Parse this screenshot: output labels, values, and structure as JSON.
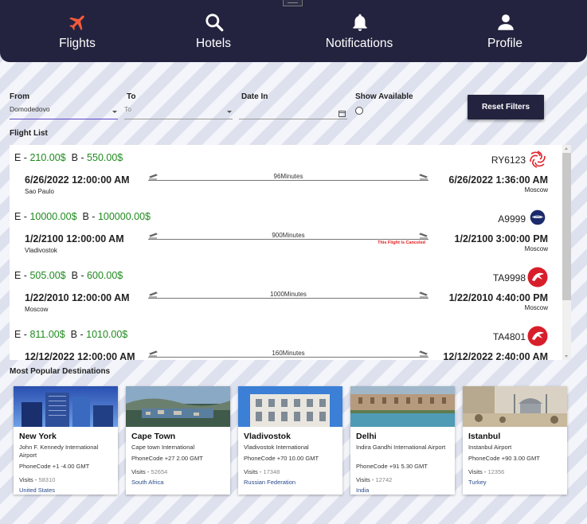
{
  "nav": {
    "items": [
      {
        "label": "Flights",
        "icon": "airplane-icon",
        "active": true
      },
      {
        "label": "Hotels",
        "icon": "search-icon"
      },
      {
        "label": "Notifications",
        "icon": "bell-icon"
      },
      {
        "label": "Profile",
        "icon": "user-icon"
      }
    ]
  },
  "filters": {
    "from": {
      "label": "From",
      "value": "Domodedovo"
    },
    "to": {
      "label": "To",
      "placeholder": "To"
    },
    "date_in": {
      "label": "Date In",
      "value": ""
    },
    "show_available": {
      "label": "Show Available"
    },
    "reset_label": "Reset Filters"
  },
  "flight_list": {
    "title": "Flight List",
    "flights": [
      {
        "economy_label": "E - ",
        "economy": "210.00$",
        "business_label": "B - ",
        "business": "550.00$",
        "number": "RY6123",
        "airline_logo": "red-swirl-logo",
        "departure_time": "6/26/2022 12:00:00 AM",
        "departure_city": "Sao Paulo",
        "arrival_time": "6/26/2022 1:36:00 AM",
        "arrival_city": "Moscow",
        "duration": "96Minutes",
        "status": ""
      },
      {
        "economy_label": "E - ",
        "economy": "10000.00$",
        "business_label": "B - ",
        "business": "100000.00$",
        "number": "A9999",
        "airline_logo": "airbus-logo",
        "departure_time": "1/2/2100 12:00:00 AM",
        "departure_city": "Vladivostok",
        "arrival_time": "1/2/2100 3:00:00 PM",
        "arrival_city": "Moscow",
        "duration": "900Minutes",
        "status": "This Flight Is Canceled"
      },
      {
        "economy_label": "E - ",
        "economy": "505.00$",
        "business_label": "B - ",
        "business": "600.00$",
        "number": "TA9998",
        "airline_logo": "turkish-airlines-logo",
        "departure_time": "1/22/2010 12:00:00 AM",
        "departure_city": "Moscow",
        "arrival_time": "1/22/2010 4:40:00 PM",
        "arrival_city": "Moscow",
        "duration": "1000Minutes",
        "status": ""
      },
      {
        "economy_label": "E - ",
        "economy": "811.00$",
        "business_label": "B - ",
        "business": "1010.00$",
        "number": "TA4801",
        "airline_logo": "turkish-airlines-logo",
        "departure_time": "12/12/2022 12:00:00 AM",
        "departure_city": "",
        "arrival_time": "12/12/2022 2:40:00 AM",
        "arrival_city": "",
        "duration": "160Minutes",
        "status": ""
      }
    ]
  },
  "destinations": {
    "title": "Most Popular Destinations",
    "items": [
      {
        "city": "New York",
        "airport": "John F. Kennedy International Airport",
        "phone": "PhoneCode +1  -4.00 GMT",
        "visits_label": "Visits - ",
        "visits": "58310",
        "country": "United States"
      },
      {
        "city": "Cape Town",
        "airport": "Cape town International",
        "phone": "PhoneCode +27  2.00 GMT",
        "visits_label": "Visits - ",
        "visits": "52654",
        "country": "South Africa"
      },
      {
        "city": "Vladivostok",
        "airport": "Vladivostok International",
        "phone": "PhoneCode +70  10.00 GMT",
        "visits_label": "Visits - ",
        "visits": "17348",
        "country": "Russian Federation"
      },
      {
        "city": "Delhi",
        "airport": "Indira Gandhi International Airport",
        "phone": "PhoneCode +91  5.30 GMT",
        "visits_label": "Visits - ",
        "visits": "12742",
        "country": "India"
      },
      {
        "city": "Istanbul",
        "airport": "Instanbul Airport",
        "phone": "PhoneCode +90  3.00 GMT",
        "visits_label": "Visits - ",
        "visits": "12356",
        "country": "Turkey"
      }
    ]
  },
  "colors": {
    "nav_bg": "#23233f",
    "accent": "#f25a3c",
    "price_green": "#1e8a1e",
    "cancel_red": "#e02020"
  }
}
